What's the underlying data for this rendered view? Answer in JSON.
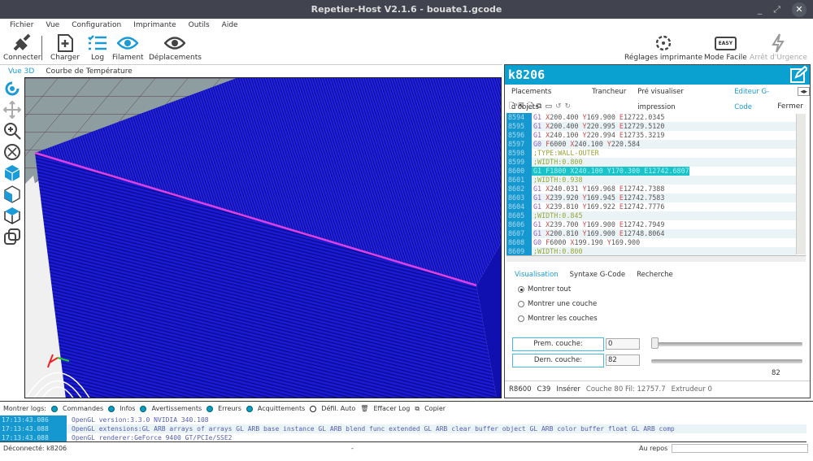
{
  "window": {
    "title": "Repetier-Host V2.1.6 - bouate1.gcode",
    "min": "_",
    "max": "⤢",
    "close": "✕"
  },
  "menu": [
    "Fichier",
    "Vue",
    "Configuration",
    "Imprimante",
    "Outils",
    "Aide"
  ],
  "toolbar": {
    "connect": "Connecter",
    "load": "Charger",
    "log": "Log",
    "filament": "Filament",
    "moves": "Déplacements",
    "printer_settings": "Réglages imprimante",
    "easy_mode": "Mode Facile",
    "easy_badge": "EASY",
    "emergency": "Arrêt d'Urgence"
  },
  "view_tabs": [
    "Vue 3D",
    "Courbe de Température"
  ],
  "panel": {
    "printer": "k8206",
    "tabs": [
      "Placements d'objets",
      "Trancheur",
      "Pré visualiser impression",
      "Editeur G-Code"
    ],
    "close": "Fermer",
    "code": [
      {
        "n": "8594",
        "t": "G1 X200.400 Y169.900 E12722.0345"
      },
      {
        "n": "8595",
        "t": "G1 X200.400 Y220.995 E12729.5120"
      },
      {
        "n": "8596",
        "t": "G1 X240.100 Y220.994 E12735.3219"
      },
      {
        "n": "8597",
        "t": "G0 F6000 X240.100 Y220.584"
      },
      {
        "n": "8598",
        "t": ";TYPE:WALL-OUTER"
      },
      {
        "n": "8599",
        "t": ";WIDTH:0.800"
      },
      {
        "n": "8600",
        "t": "G1 F1800 X240.100 Y170.300 E12742.6807",
        "hl": true
      },
      {
        "n": "8601",
        "t": ";WIDTH:0.938"
      },
      {
        "n": "8602",
        "t": "G1 X240.031 Y169.968 E12742.7388"
      },
      {
        "n": "8603",
        "t": "G1 X239.920 Y169.945 E12742.7583"
      },
      {
        "n": "8604",
        "t": "G1 X239.810 Y169.922 E12742.7776"
      },
      {
        "n": "8605",
        "t": ";WIDTH:0.845"
      },
      {
        "n": "8606",
        "t": "G1 X239.700 Y169.900 E12742.7949"
      },
      {
        "n": "8607",
        "t": "G1 X200.810 Y169.900 E12748.8064"
      },
      {
        "n": "8608",
        "t": "G0 F6000 X199.190 Y169.900"
      },
      {
        "n": "8609",
        "t": ";WIDTH:0.800"
      }
    ],
    "subtabs": [
      "Visualisation",
      "Syntaxe G-Code",
      "Recherche"
    ],
    "radios": [
      {
        "label": "Montrer tout",
        "on": true
      },
      {
        "label": "Montrer une couche",
        "on": false
      },
      {
        "label": "Montrer les couches",
        "on": false
      }
    ],
    "first_layer_label": "Prem. couche:",
    "first_layer": "0",
    "last_layer_label": "Dern. couche:",
    "last_layer": "82",
    "slider_value": "82",
    "status": [
      "R8600",
      "C39",
      "Insérer",
      "Couche 80 Fil: 12757.7",
      "Extrudeur 0"
    ]
  },
  "logbar": {
    "label": "Montrer logs:",
    "items": [
      {
        "label": "Commandes",
        "on": true
      },
      {
        "label": "Infos",
        "on": true
      },
      {
        "label": "Avertissements",
        "on": true
      },
      {
        "label": "Erreurs",
        "on": true
      },
      {
        "label": "Acquittements",
        "on": true
      },
      {
        "label": "Défil. Auto",
        "on": false
      }
    ],
    "clear": "Effacer Log",
    "copy": "Copier"
  },
  "logs": [
    {
      "t": "17:13:43.086",
      "m": "OpenGL version:3.3.0 NVIDIA 340.108"
    },
    {
      "t": "17:13:43.088",
      "m": "OpenGL extensions:GL ARB arrays of arrays GL ARB base instance GL ARB blend func extended GL ARB clear buffer object GL ARB color buffer float GL ARB comp"
    },
    {
      "t": "17:13:43.088",
      "m": "OpenGL renderer:GeForce 9400 GT/PCIe/SSE2"
    }
  ],
  "statusbar": {
    "conn": "Déconnecté: k8206",
    "mid": "-",
    "state": "Au repos"
  }
}
